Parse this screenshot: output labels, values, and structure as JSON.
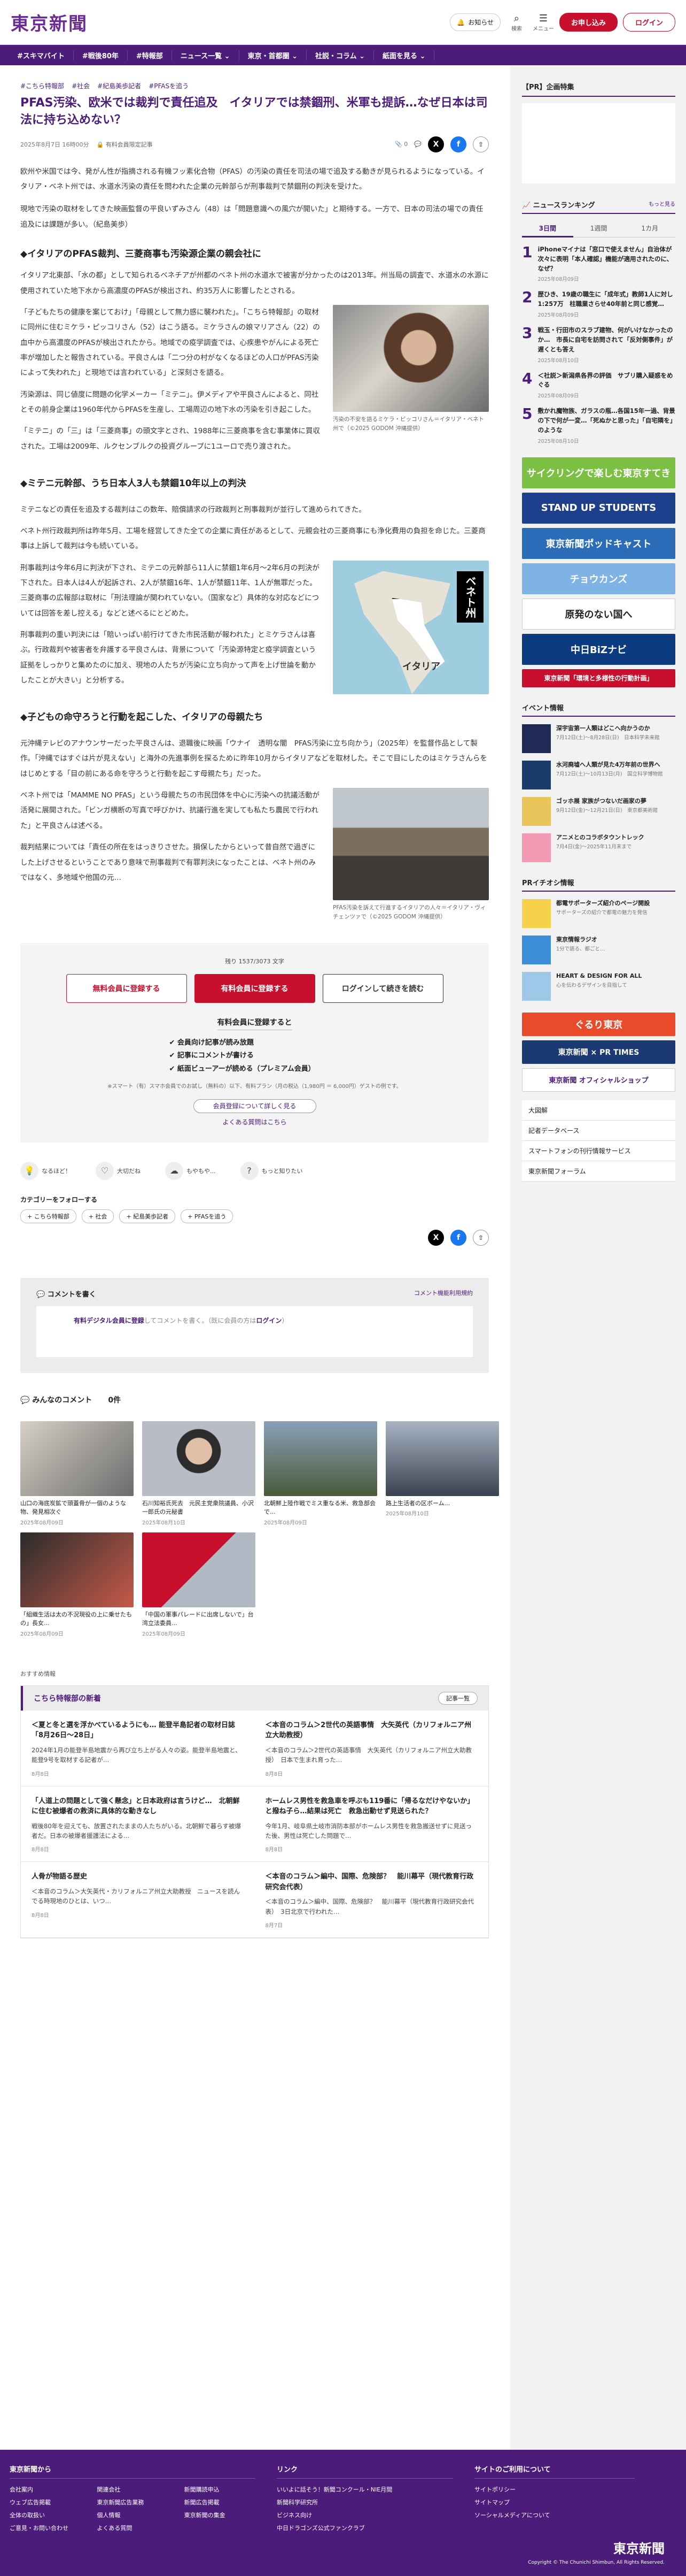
{
  "header": {
    "logo": "東京新聞",
    "notice": "お知らせ",
    "search": "検索",
    "menu": "メニュー",
    "register": "お申し込み",
    "login": "ログイン"
  },
  "nav": [
    "#スキマバイト",
    "#戦後80年",
    "#特報部",
    "ニュース一覧 ⌄",
    "東京・首都圏 ⌄",
    "社説・コラム ⌄",
    "紙面を見る ⌄"
  ],
  "article": {
    "tags": [
      "#こちら特報部",
      "#社会",
      "#紀島美歩記者",
      "#PFASを追う"
    ],
    "title": "PFAS汚染、欧米では裁判で責任追及　イタリアでは禁錮刑、米軍も提訴…なぜ日本は司法に持ち込めない？",
    "date": "2025年8月7日 16時00分",
    "lock": "有料会員限定記事",
    "bookmark_count": "0",
    "lead": [
      "欧州や米国では今、発がん性が指摘される有機フッ素化合物（PFAS）の汚染の責任を司法の場で追及する動きが見られるようになっている。イタリア・ベネト州では、水道水汚染の責任を問われた企業の元幹部らが刑事裁判で禁錮刑の判決を受けた。",
      "現地で汚染の取材をしてきた映画監督の平良いずみさん（48）は「問題意識への風穴が開いた」と期待する。一方で、日本の司法の場での責任追及には課題が多い。（紀島美歩）"
    ],
    "sec1": "◆イタリアのPFAS裁判、三菱商事も汚染源企業の親会社に",
    "sec1_body": [
      "イタリア北東部、「水の都」として知られるベネチアが州都のベネト州の水道水で被害が分かったのは2013年。州当局の調査で、水道水の水源に使用されていた地下水から高濃度のPFASが検出され、約35万人に影響したとされる。",
      "「子どもたちの健康を案じておけ」「母親として無力感に襲われた」。「こちら特報部」の取材に同州に住むミケラ・ピッコリさん（52）はこう語る。ミケラさんの娘マリアさん（22）の血中から高濃度のPFASが検出されたから。地域での疫学調査では、心疾患やがんによる死亡率が増加したと報告されている。平良さんは「二つ分の村がなくなるほどの人口がPFAS汚染によって失われた」と現地では言われている」と深刻さを語る。",
      "汚染源は、同じ値度に問題の化学メーカー「ミテニ」。伊メディアや平良さんによると、同社とその前身企業は1960年代からPFASを生産し、工場周辺の地下水の汚染を引き起こした。",
      "「ミテニ」の「三」は「三菱商事」の頭文字とされ、1988年に三菱商事を含む事業体に買収された。工場は2009年、ルクセンブルクの投資グループに1ユーロで売り渡された。"
    ],
    "fig1_caption": "汚染の不安を語るミケラ・ピッコリさん＝イタリア・ベネト州で（©2025 GODOM 沖縄提供）",
    "sec2": "◆ミテニ元幹部、うち日本人3人も禁錮10年以上の判決",
    "sec2_body": [
      "ミテニなどの責任を追及する裁判はこの数年、賠償請求の行政裁判と刑事裁判が並行して進められてきた。",
      "ベネト州行政裁判所は昨年5月、工場を経営してきた全ての企業に責任があるとして、元親会社の三菱商事にも浄化費用の負担を命じた。三菱商事は上訴して裁判は今も続いている。",
      "刑事裁判は今年6月に判決が下され、ミテニの元幹部ら11人に禁錮1年6月〜2年6月の判決が下された。日本人は4人が起訴され、2人が禁錮16年、1人が禁錮11年、1人が無罪だった。三菱商事の広報部は取材に「刑法理論が関われていない。（国家など）具体的な対応などについては回答を差し控える」などと述べるにとどめた。",
      "刑事裁判の重い判決には「賠いっぱい前行けてきた市民活動が報われた」とミケラさんは喜ぶ。行政裁判や被害者を弁護する平良さんは、背景について「汚染源特定と疫学調査という証拠をしっかりと集めたのに加え、現地の人たちが汚染に立ち向かって声を上げ世論を動かしたことが大きい」と分析する。"
    ],
    "fig2_label_vertical": "ベネト州",
    "fig2_label_italy": "イタリア",
    "sec3": "◆子どもの命守ろうと行動を起こした、イタリアの母親たち",
    "sec3_body": [
      "元沖縄テレビのアナウンサーだった平良さんは、退職後に映画「ウナイ　透明な闇　PFAS汚染に立ち向かう」（2025年）を監督作品として製作。「沖縄ではすぐは片が見えない」と海外の先進事例を探るために昨年10月からイタリアなどを取材した。そこで目にしたのはミケラさんらをはじめとする「目の前にある命を守ろうと行動を起こす母親たち」だった。",
      "ベネト州では「MAMME NO PFAS」という母親たちの市民団体を中心に汚染への抗議活動が活発に展開された。「ビンガ横断の写真で呼びかけ、抗議行進を実しても私たち農民で行われた」と平良さんは述べる。",
      "裁判結果については「責任の所在をはっきりさせた。損保したからといって昔自然で過ぎにした上げさせるということであり意味で刑事裁判で有罪判決になったことは、ベネト州のみではなく、多地域や他国の元…"
    ],
    "fig3_caption": "PFAS汚染を訴えて行進するイタリアの人々＝イタリア・ヴィチェンツァで（©2025 GODOM 沖縄提供）"
  },
  "paywall": {
    "count": "残り 1537/3073 文字",
    "free_btn": "無料会員に登録する",
    "paid_btn": "有料会員に登録する",
    "read_btn": "ログインして続きを読む",
    "sub": "有料会員に登録すると",
    "benefits": [
      "✔ 会員向け記事が読み放題",
      "✔ 記事にコメントが書ける",
      "✔ 紙面ビューアーが読める（プレミアム会員）"
    ],
    "note": "※スマート（有）スマホ会員でのお試し（無料の）以下、有料プラン（月の税込（1,980円 ＝ 6,000円）ゲストの例です。",
    "link1": "会員登録について詳しく見る",
    "faq": "よくある質問はこちら"
  },
  "reactions": [
    "なるほど！",
    "大切だね",
    "もやもや...",
    "もっと知りたい"
  ],
  "follow": {
    "title": "カテゴリーをフォローする",
    "tags": [
      "+ こちら特報部",
      "+ 社会",
      "+ 紀島美歩記者",
      "+ PFASを追う"
    ]
  },
  "comment": {
    "title": "コメントを書く",
    "guide": "コメント機能利用規約",
    "inner_link": "有料デジタル会員に登録",
    "inner_text": "してコメントを書く。（既に会員の方は",
    "inner_login": "ログイン",
    "inner_end": "）"
  },
  "comments_h": "みんなのコメント",
  "comments_count": "0件",
  "news_grid": [
    {
      "t": "山口の海底炭鉱で頭蓋骨が一個のような物、発見相次ぐ",
      "d": "2025年08月09日"
    },
    {
      "t": "石川知裕氏死去　元民主党衆院議員、小沢一郎氏の元秘書",
      "d": "2025年08月10日"
    },
    {
      "t": "北朝鮮上陸作戦でミス重なる米、救急部会で...",
      "d": "2025年08月09日"
    },
    {
      "t": "路上生活者の区ボーム...",
      "d": "2025年08月10日"
    },
    {
      "t": "「組織生活は太の不況現役の上に乗せたもの」長女...",
      "d": "2025年08月09日"
    },
    {
      "t": "「中国の軍事パレードに出席しないで」台湾立法委員...",
      "d": "2025年08月09日"
    }
  ],
  "reco_label": "おすすめ情報",
  "tokuho": {
    "title": "こちら特報部の新着",
    "more": "記事一覧",
    "items": [
      {
        "t": "＜夏と冬と選を浮かべているようにも… 能登半島記者の取材日誌「8月26日〜28日」",
        "s": "2024年1月の能登半島地震から再び立ち上がる人々の姿。能登半島地震と、能登9号を取材する記者が…",
        "d": "8月8日"
      },
      {
        "t": "＜本音のコラム＞2世代の英語事情　大矢英代（カリフォルニア州立大助教授）",
        "s": "＜本音のコラム＞2世代の英語事情　大矢英代（カリフォルニア州立大助教授）　日本で生まれ育った…",
        "d": "8月8日"
      },
      {
        "t": "「人道上の問題として強く懸念」と日本政府は言うけど…　北朝鮮に住む被爆者の救済に具体的な動きなし",
        "s": "戦後80年を迎えても、放置されたままの人たちがいる。北朝鮮で暮らす被爆者だ。日本の被爆者援護法による…",
        "d": "8月8日"
      },
      {
        "t": "ホームレス男性を救急車を呼ぶも119番に「帰るなだけやないか」と撥ね子ら…結果は死亡　救急出動せず見送られた？",
        "s": "今年1月、岐阜県土岐市消防本部がホームレス男性を救急搬送せずに見送った後、男性は死亡した問題で…",
        "d": "8月8日"
      },
      {
        "t": "人骨が物語る歴史",
        "s": "＜本音のコラム＞大矢英代・カリフォルニア州立大助教授　ニュースを読んでる時現地のひとは、いつ…",
        "d": "8月8日"
      },
      {
        "t": "＜本音のコラム＞編中、国際、危険部？　能川幕平（現代教育行政研究会代表）",
        "s": "＜本音のコラム＞編中、国際、危険部？　能川幕平（現代教育行政研究会代表）　3日北京で行われた…",
        "d": "8月7日"
      }
    ]
  },
  "sidebar": {
    "pr_title": "【PR】企画特集",
    "ranking_title": "ニュースランキング",
    "ranking_more": "もっと見る",
    "tabs": [
      "3日間",
      "1週間",
      "1カ月"
    ],
    "ranking": [
      {
        "t": "iPhoneマイナは「窓口で使えません」自治体が次々に表明「本人確認」機能が適用されたのに、なぜ？",
        "d": "2025年08月09日"
      },
      {
        "t": "歴ひき、19歳の職生に「成年式」教師1人に対し1:257万　柱職業さらせ40年前と同じ感覚…",
        "d": "2025年08月09日"
      },
      {
        "t": "戦玉・行田市のスラブ建物、何がいけなかったのか…　市長に自宅を訪問されて「反対側事件」が遅くとも答え",
        "d": "2025年08月10日"
      },
      {
        "t": "＜社説＞新潟県各界の評価　サブリ購入疑惑をめぐる",
        "d": "2025年08月09日"
      },
      {
        "t": "敷かれ魔物族、ガラスの瓶…各国15年一過、背景の下で何が一変…「死ぬかと思った」「自宅隣を」のような",
        "d": "2025年08月10日"
      }
    ],
    "banners": [
      {
        "t": "サイクリングで楽しむ東京すてき",
        "c": "#7cc043"
      },
      {
        "t": "STAND UP STUDENTS",
        "c": "#1e3f8b"
      },
      {
        "t": "東京新聞ポッドキャスト",
        "c": "#2b6cb8"
      },
      {
        "t": "チョウカンズ",
        "c": "#7fb2e5"
      },
      {
        "t": "原発のない国へ",
        "c": "#ffffff"
      },
      {
        "t": "中日BiZナビ",
        "c": "#0d3b80"
      },
      {
        "t": "東京新聞「環境と多様性の行動計画」",
        "c": "#c8102e"
      }
    ],
    "event_title": "イベント情報",
    "events": [
      {
        "t": "深宇宙第一人類はどこへ向かうのか",
        "s": "7月12日(土)〜8月28日(日)　日本科学未来館"
      },
      {
        "t": "水河廃墟へ人類が見た4万年前の世界へ",
        "s": "7月12日(土)〜10月13日(月)　国立科学博物館"
      },
      {
        "t": "ゴッホ展 家族がつないだ画家の夢",
        "s": "9月12日(金)〜12月21日(日)　東京都美術館"
      },
      {
        "t": "アニメとのコラボタウントレック",
        "s": "7月4日(金)〜2025年11月末まで"
      }
    ],
    "pr_event": "PRイチオシ情報",
    "pr_items": [
      {
        "t": "都電サポーターズ紹介のページ開設",
        "s": "サポーターズの紹介で都電の魅力を発信"
      },
      {
        "t": "東京情報ラジオ",
        "s": "1分で語る、都ごと…"
      },
      {
        "t": "HEART & DESIGN FOR ALL",
        "s": "心を伝わるデザインを目指して"
      }
    ],
    "links": [
      "大図解",
      "記者データベース",
      "スマートフォンの刊行情報サービス",
      "東京新聞フォーラム"
    ]
  },
  "footer": {
    "col1": "東京新聞から",
    "col1_links": [
      "会社案内",
      "関連会社",
      "新聞購読申込",
      "ウェブ広告掲載",
      "東京新聞広告業務",
      "新聞広告掲載",
      "全体の取扱い",
      "個人情報",
      "東京新聞の集金",
      "ご意見・お問い合わせ",
      "よくある質問"
    ],
    "col2": "リンク",
    "col2_links": [
      "いいよに話そう！新聞コンクール・NIE月間",
      "新聞科学研究所",
      "ビジネス向け",
      "中日ドラゴンズ公式ファンクラブ"
    ],
    "col3": "サイトのご利用について",
    "col3_links": [
      "サイトポリシー",
      "サイトマップ",
      "ソーシャルメディアについて"
    ],
    "logo": "東京新聞",
    "copy": "Copyright © The Chunichi Shimbun, All Rights Reserved."
  }
}
